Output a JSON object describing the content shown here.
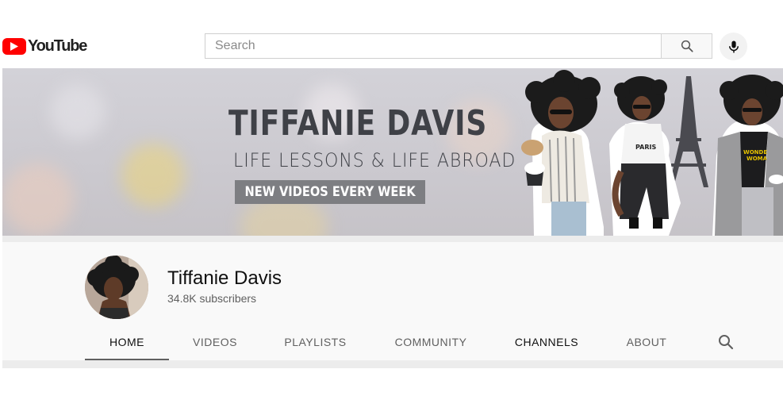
{
  "header": {
    "logo_text": "YouTube",
    "search": {
      "placeholder": "Search",
      "value": ""
    }
  },
  "banner": {
    "title": "TIFFANIE DAVIS",
    "subtitle": "LIFE LESSONS & LIFE ABROAD",
    "tagline": "NEW VIDEOS EVERY WEEK",
    "photo_tshirt_texts": [
      "PARIS",
      "WONDER WOMAN"
    ]
  },
  "channel": {
    "name": "Tiffanie Davis",
    "subscribers": "34.8K subscribers"
  },
  "tabs": [
    {
      "label": "HOME",
      "active": true
    },
    {
      "label": "VIDEOS",
      "active": false
    },
    {
      "label": "PLAYLISTS",
      "active": false
    },
    {
      "label": "COMMUNITY",
      "active": false
    },
    {
      "label": "CHANNELS",
      "active": false
    },
    {
      "label": "ABOUT",
      "active": false
    }
  ],
  "icons": {
    "logo": "youtube-logo-icon",
    "search": "search-icon",
    "mic": "microphone-icon",
    "channel_search": "search-icon"
  },
  "colors": {
    "brand_red": "#ff0000",
    "tag_background": "#7d7e82",
    "header_background": "#f9f9f9",
    "active_tab_underline": "#606060"
  }
}
